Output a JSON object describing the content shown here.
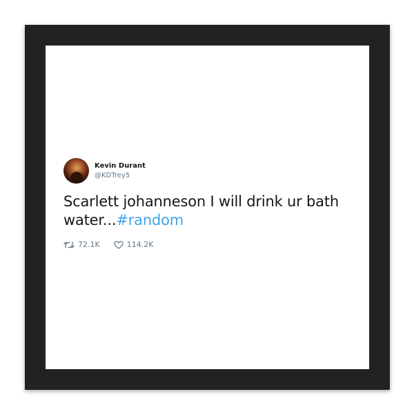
{
  "tweet": {
    "display_name": "Kevin Durant",
    "handle": "@KDTrey5",
    "text": "Scarlett johanneson I will drink ur bath water...",
    "hashtag": "#random",
    "retweet_count": "72.1K",
    "like_count": "114.2K"
  },
  "colors": {
    "frame": "#222222",
    "hashtag": "#3ea3e8",
    "muted": "#657786"
  },
  "icons": {
    "retweet": "retweet-icon",
    "like": "heart-icon"
  }
}
